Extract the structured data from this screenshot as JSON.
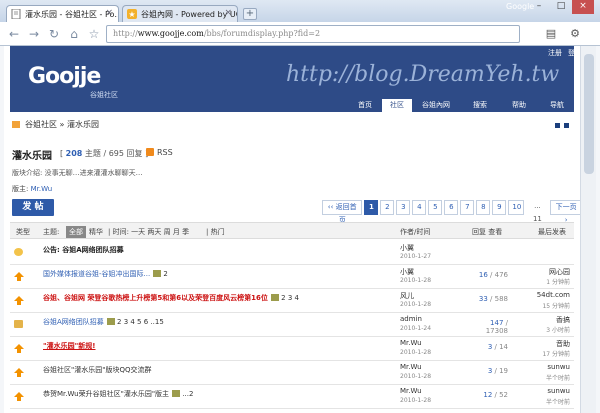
{
  "browser": {
    "tabs": [
      {
        "title": "灌水乐园 - 谷姐社区 - Po…",
        "active": true
      },
      {
        "title": "谷姐內网 - Powered by UC…",
        "active": false
      }
    ],
    "brand": "Google",
    "url_prefix": "http://",
    "url_host": "www.goojje.com",
    "url_path": "/bbs/forumdisplay.php?fid=2"
  },
  "header": {
    "toplinks": [
      "注册",
      "登录"
    ],
    "logo": "Goojje",
    "logo_sub": "谷姐社区",
    "blog_title": "http://blog.DreamYeh.tw",
    "nav": [
      "首页",
      "社区",
      "谷姐內网",
      "搜索",
      "帮助",
      "导航"
    ],
    "nav_active_index": 1
  },
  "breadcrumb": {
    "root": "谷姐社区",
    "sep": "»",
    "current": "灌水乐园"
  },
  "forum": {
    "title": "灌水乐园",
    "topics": "208",
    "posts": "695",
    "counts_open": "[",
    "counts_topic_unit": "主题 /",
    "counts_post_unit": "回复 ]",
    "rss": "RSS",
    "intro": "版块介绍: 没事无聊…进来灌灌水聊聊天…",
    "mods_label": "版主:",
    "mods": "Mr.Wu"
  },
  "post_button": "发 帖",
  "pager": {
    "first": "‹‹ 返回首页",
    "pages": [
      "1",
      "2",
      "3",
      "4",
      "5",
      "6",
      "7",
      "8",
      "9",
      "10"
    ],
    "ellipsis": "... 11",
    "next": "下一页 ›"
  },
  "filter": {
    "type": "类型",
    "topic": "主题:",
    "all": "全部",
    "digest": "精华",
    "time": "| 时间: 一天 两天 周 月 季",
    "hot": "| 热门",
    "author": "作者/时间",
    "replies": "回复 查看",
    "last": "最后发表"
  },
  "threads": [
    {
      "style": "bold",
      "title": "公告: 谷姐A网络团队招募",
      "pages": "",
      "author": "小翼",
      "date": "2010-1-27",
      "replies": "",
      "views": "",
      "last_user": "",
      "last_time": "",
      "icon": "speaker"
    },
    {
      "style": "link",
      "title": "国外媒体报道谷姐-谷姐冲出国际...",
      "pages": "2",
      "author": "小翼",
      "date": "2010-1-28",
      "replies": "16",
      "views": "476",
      "last_user": "网心园",
      "last_time": "1 分钟前",
      "icon": "up"
    },
    {
      "style": "red",
      "title": "谷姐、谷姐网 荣登谷歌热榜上升榜第5和第6以及荣登百度风云榜第16位",
      "pages": "2 3 4",
      "author": "风儿",
      "date": "2010-1-28",
      "replies": "33",
      "views": "588",
      "last_user": "54dt.com",
      "last_time": "15 分钟前",
      "icon": "up"
    },
    {
      "style": "link",
      "title": "谷姐A网络团队招募",
      "pages": "2 3 4 5 6 ..15",
      "author": "admin",
      "date": "2010-1-24",
      "replies": "147",
      "views": "17308",
      "last_user": "香搞",
      "last_time": "3 小时前",
      "icon": "lock"
    },
    {
      "style": "ul",
      "title": "\"灌水乐园\"新规!",
      "pages": "",
      "author": "Mr.Wu",
      "date": "2010-1-28",
      "replies": "3",
      "views": "14",
      "last_user": "音助",
      "last_time": "17 分钟前",
      "icon": "up"
    },
    {
      "style": "plain",
      "title": "谷姐社区\"灌水乐园\"版块QQ交流群",
      "pages": "",
      "author": "Mr.Wu",
      "date": "2010-1-28",
      "replies": "3",
      "views": "19",
      "last_user": "sunwu",
      "last_time": "半个时前",
      "icon": "up"
    },
    {
      "style": "plain",
      "title": "恭贺Mr.Wu荣升谷姐社区\"灌水乐园\"版主",
      "pages": "...2",
      "author": "Mr.Wu",
      "date": "2010-1-28",
      "replies": "12",
      "views": "52",
      "last_user": "sunwu",
      "last_time": "半个时前",
      "icon": "up"
    }
  ],
  "partial_row": "版块主题"
}
